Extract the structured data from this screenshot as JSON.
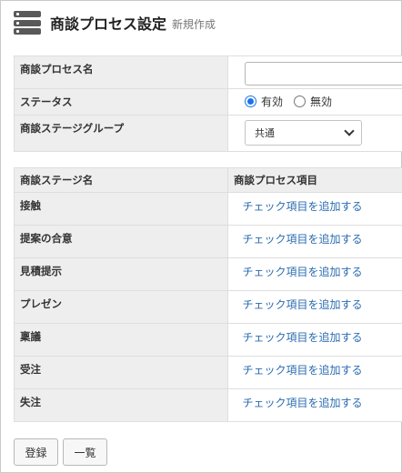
{
  "header": {
    "icon": "database-server-icon",
    "title": "商談プロセス設定",
    "subtitle": "新規作成"
  },
  "form": {
    "name_label": "商談プロセス名",
    "name_value": "",
    "status_label": "ステータス",
    "status_options": [
      "有効",
      "無効"
    ],
    "status_selected": "有効",
    "group_label": "商談ステージグループ",
    "group_value": "共通"
  },
  "stages": {
    "header_stage": "商談ステージ名",
    "header_items": "商談プロセス項目",
    "link_label": "チェック項目を追加する",
    "rows": [
      {
        "name": "接触"
      },
      {
        "name": "提案の合意"
      },
      {
        "name": "見積提示"
      },
      {
        "name": "プレゼン"
      },
      {
        "name": "稟議"
      },
      {
        "name": "受注"
      },
      {
        "name": "失注"
      }
    ]
  },
  "footer": {
    "register_label": "登録",
    "list_label": "一覧"
  }
}
